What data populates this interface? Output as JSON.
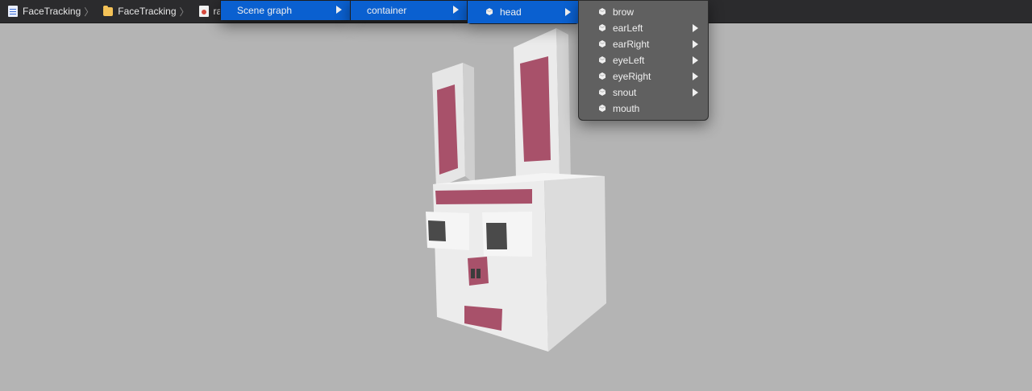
{
  "breadcrumb": {
    "items": [
      {
        "label": "FaceTracking",
        "icon": "project-file-icon"
      },
      {
        "label": "FaceTracking",
        "icon": "folder-icon"
      },
      {
        "label": "rabbit.sc",
        "icon": "scene-file-icon"
      }
    ]
  },
  "menus": {
    "scene_graph": {
      "label": "Scene graph"
    },
    "container": {
      "label": "container"
    },
    "head": {
      "label": "head"
    },
    "children": [
      {
        "label": "brow",
        "has_submenu": false
      },
      {
        "label": "earLeft",
        "has_submenu": true
      },
      {
        "label": "earRight",
        "has_submenu": true
      },
      {
        "label": "eyeLeft",
        "has_submenu": true
      },
      {
        "label": "eyeRight",
        "has_submenu": true
      },
      {
        "label": "snout",
        "has_submenu": true
      },
      {
        "label": "mouth",
        "has_submenu": false
      }
    ]
  },
  "colors": {
    "selection": "#0a60d0",
    "viewport_bg": "#b4b4b4",
    "rabbit_white": "#e8e8e8",
    "rabbit_pink": "#a8516a",
    "eye_dark": "#4a4a4a"
  }
}
